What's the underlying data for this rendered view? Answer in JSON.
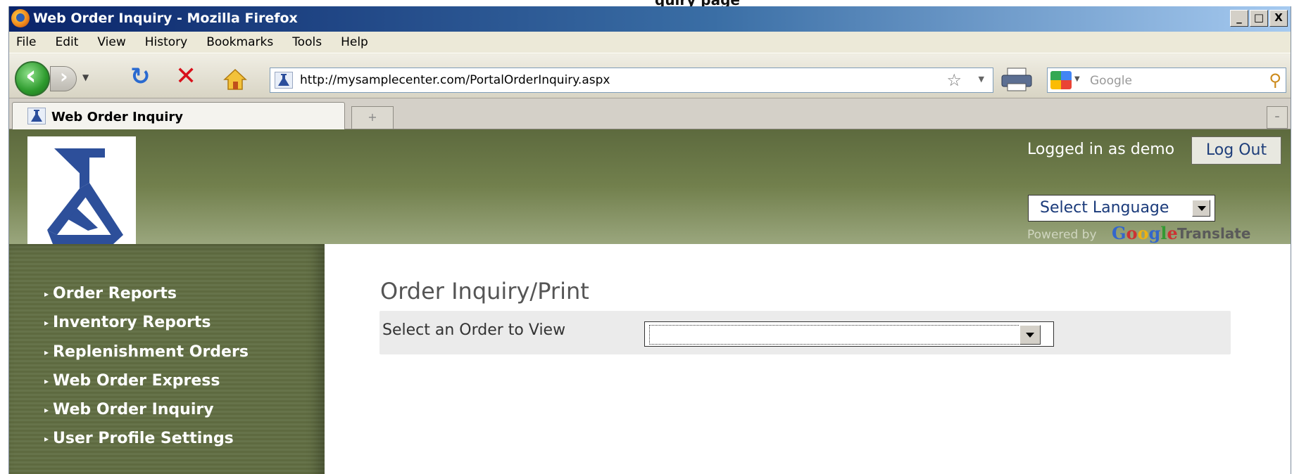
{
  "caption_fragment": "quiry page",
  "window": {
    "title": "Web Order Inquiry - Mozilla Firefox",
    "controls": [
      "_",
      "□",
      "X"
    ]
  },
  "menu": [
    "File",
    "Edit",
    "View",
    "History",
    "Bookmarks",
    "Tools",
    "Help"
  ],
  "nav": {
    "url": "http://mysamplecenter.com/PortalOrderInquiry.aspx",
    "search_placeholder": "Google",
    "icons": [
      "back-arrow",
      "forward-arrow",
      "history-dropdown",
      "reload",
      "stop",
      "home",
      "bookmark-star",
      "print",
      "search-engine",
      "magnifier"
    ]
  },
  "tabs": {
    "active": "Web Order Inquiry",
    "new_tab_symbol": "+",
    "list_symbol": "–"
  },
  "header": {
    "logged_in": "Logged in as demo",
    "logout": "Log Out",
    "language": "Select Language",
    "powered_by": "Powered by",
    "google_letters": [
      "G",
      "o",
      "o",
      "g",
      "l",
      "e"
    ],
    "translate": "Translate"
  },
  "sidebar": {
    "items": [
      "Order Reports",
      "Inventory Reports",
      "Replenishment Orders",
      "Web Order Express",
      "Web Order Inquiry",
      "User Profile Settings"
    ]
  },
  "main": {
    "title": "Order Inquiry/Print",
    "form_label": "Select an Order to View",
    "selected_order": ""
  }
}
